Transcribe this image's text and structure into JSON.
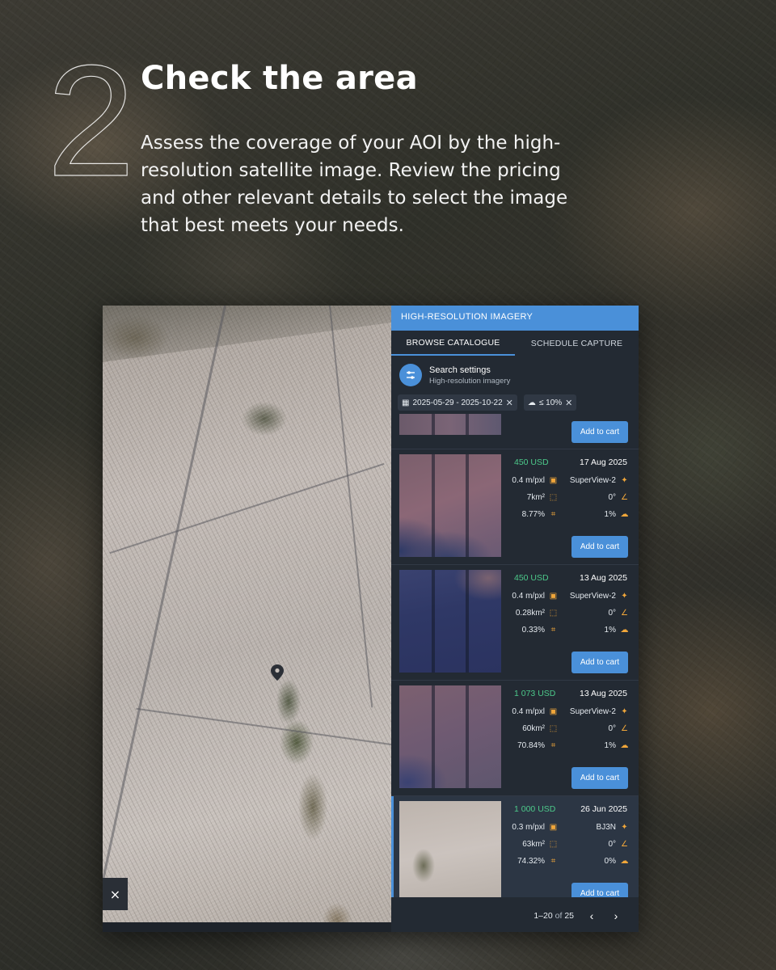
{
  "step": {
    "number": "2",
    "title": "Check the area",
    "description": "Assess the coverage of your AOI by the high-resolution satellite image. Review the pricing and other relevant details to select the image that best meets your needs."
  },
  "panel": {
    "header": "HIGH-RESOLUTION IMAGERY",
    "tabs": [
      {
        "label": "BROWSE CATALOGUE",
        "active": true
      },
      {
        "label": "SCHEDULE CAPTURE",
        "active": false
      }
    ],
    "search_settings": {
      "title": "Search settings",
      "subtitle": "High-resolution imagery"
    },
    "filters": {
      "date_range": "2025-05-29 - 2025-10-22",
      "cloud": "≤ 10%"
    },
    "add_to_cart_label": "Add to cart",
    "results": [
      {
        "price": "450 USD",
        "date": "17 Aug 2025",
        "resolution": "0.4  m/pxl",
        "satellite": "SuperView-2",
        "area": "7km²",
        "angle": "0°",
        "coverage": "8.77%",
        "clouds": "1%",
        "selected": false
      },
      {
        "price": "450 USD",
        "date": "13 Aug 2025",
        "resolution": "0.4  m/pxl",
        "satellite": "SuperView-2",
        "area": "0.28km²",
        "angle": "0°",
        "coverage": "0.33%",
        "clouds": "1%",
        "selected": false
      },
      {
        "price": "1 073 USD",
        "date": "13 Aug 2025",
        "resolution": "0.4  m/pxl",
        "satellite": "SuperView-2",
        "area": "60km²",
        "angle": "0°",
        "coverage": "70.84%",
        "clouds": "1%",
        "selected": false
      },
      {
        "price": "1 000 USD",
        "date": "26 Jun 2025",
        "resolution": "0.3  m/pxl",
        "satellite": "BJ3N",
        "area": "63km²",
        "angle": "0°",
        "coverage": "74.32%",
        "clouds": "0%",
        "selected": true
      }
    ],
    "pagination": {
      "range": "1–20",
      "of_label": "of",
      "total": "25"
    }
  },
  "map": {
    "close_symbol": "×"
  },
  "colors": {
    "accent": "#4a90d9",
    "price": "#4cc98a",
    "icon": "#f0a63a",
    "panel_bg": "#232a33"
  },
  "icons": [
    "sliders-icon",
    "calendar-icon",
    "cloud-icon",
    "resolution-icon",
    "satellite-icon",
    "area-icon",
    "angle-icon",
    "crop-icon",
    "sun-cloud-icon",
    "chevron-left-icon",
    "chevron-right-icon",
    "map-pin-icon",
    "close-icon"
  ]
}
